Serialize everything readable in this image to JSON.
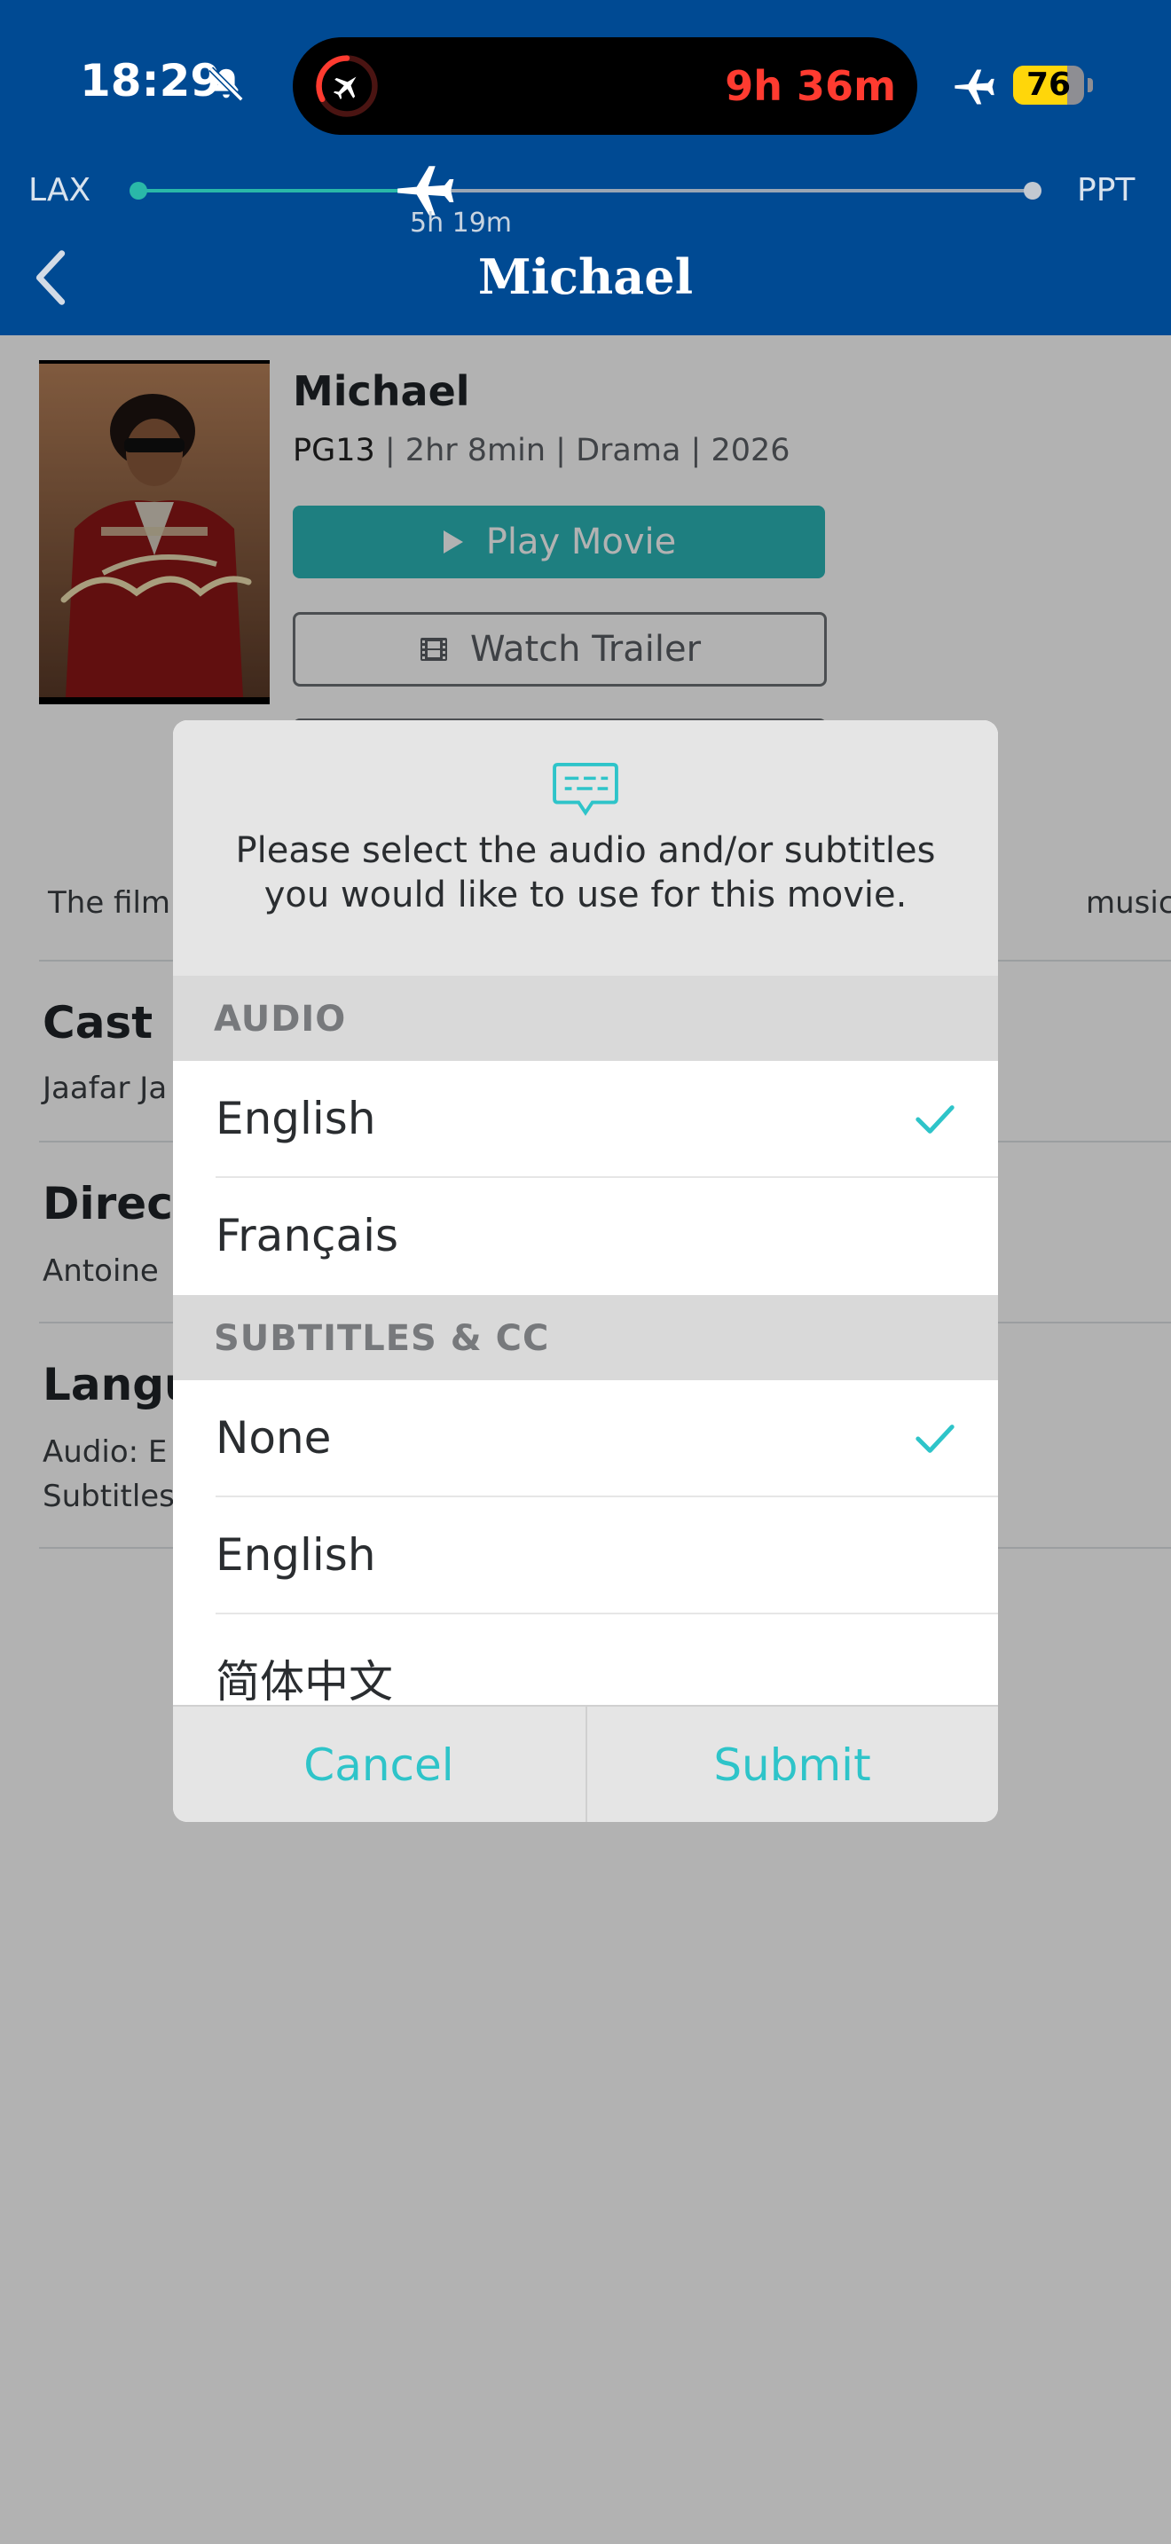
{
  "status_bar": {
    "time": "18:29",
    "flight_remaining": "9h 36m",
    "battery": "76",
    "battery_level": 0.76
  },
  "flight_tracker": {
    "origin": "LAX",
    "destination": "PPT",
    "elapsed": "5h 19m",
    "progress": 0.32
  },
  "nav": {
    "title": "Michael"
  },
  "movie": {
    "title": "Michael",
    "rating": "PG13",
    "meta": " | 2hr 8min | Drama | 2026",
    "play_label": "Play Movie",
    "trailer_label": "Watch Trailer",
    "synopsis_start": "The film",
    "synopsis_end": "music."
  },
  "sections": {
    "cast": {
      "heading": "Cast",
      "text": "Jaafar Ja"
    },
    "director": {
      "heading": "Direct",
      "text": "Antoine"
    },
    "languages": {
      "heading": "Langu",
      "audio_line": "Audio: E",
      "subtitles_line": "Subtitles"
    }
  },
  "modal": {
    "message": "Please select the audio and/or subtitles you would like to use for this movie.",
    "audio_heading": "AUDIO",
    "audio_options": [
      {
        "label": "English",
        "selected": true
      },
      {
        "label": "Français",
        "selected": false
      }
    ],
    "subtitles_heading": "SUBTITLES & CC",
    "subtitle_options": [
      {
        "label": "None",
        "selected": true
      },
      {
        "label": "English",
        "selected": false
      },
      {
        "label": "简体中文",
        "selected": false
      }
    ],
    "cancel_label": "Cancel",
    "submit_label": "Submit"
  },
  "colors": {
    "header": "#004a93",
    "accent": "#2cb6b8",
    "eta_red": "#ff3b30"
  }
}
